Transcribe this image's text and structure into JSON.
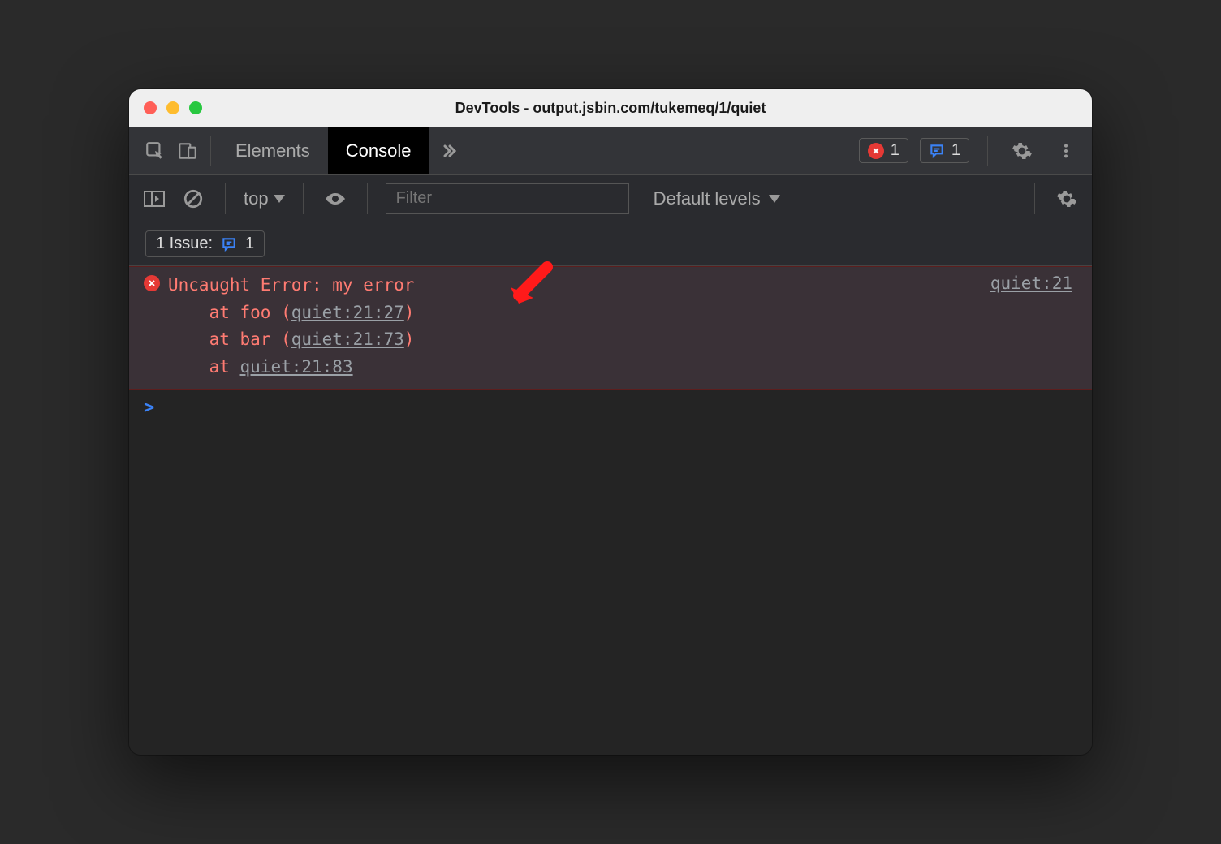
{
  "window": {
    "title": "DevTools - output.jsbin.com/tukemeq/1/quiet"
  },
  "tabs": {
    "elements": "Elements",
    "console": "Console"
  },
  "counters": {
    "errors": "1",
    "issues": "1"
  },
  "toolbar": {
    "context": "top",
    "filter_placeholder": "Filter",
    "levels_label": "Default levels"
  },
  "issuebar": {
    "prefix": "1 Issue:",
    "count": "1"
  },
  "error": {
    "message": "Uncaught Error: my error",
    "source_right": "quiet:21",
    "stack": [
      {
        "prefix": "    at foo (",
        "link": "quiet:21:27",
        "suffix": ")"
      },
      {
        "prefix": "    at bar (",
        "link": "quiet:21:73",
        "suffix": ")"
      },
      {
        "prefix": "    at ",
        "link": "quiet:21:83",
        "suffix": ""
      }
    ]
  },
  "prompt": ">"
}
